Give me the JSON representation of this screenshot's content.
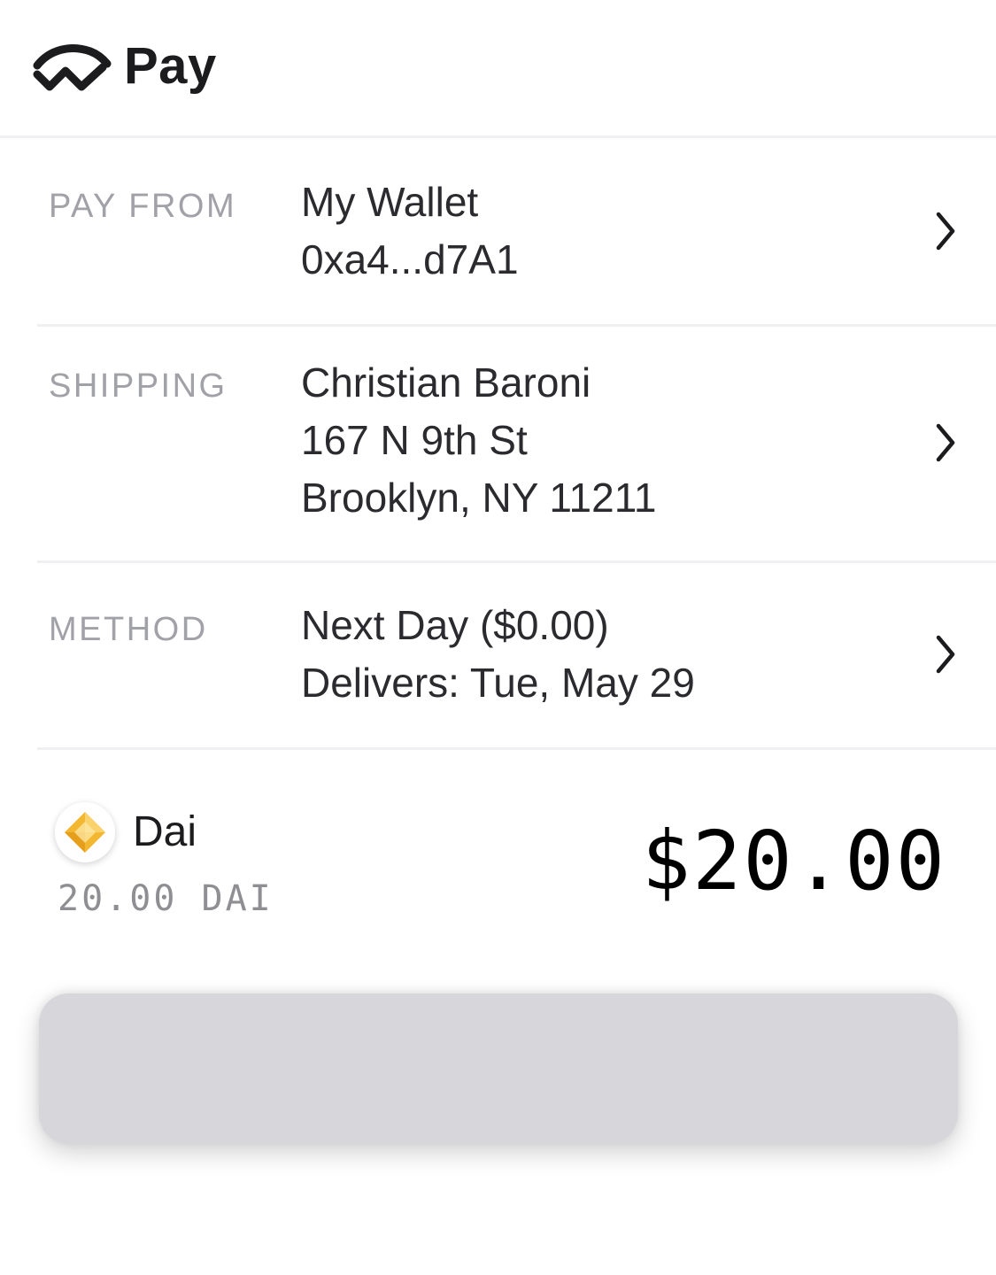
{
  "header": {
    "title": "Pay",
    "logo_icon": "walletconnect-logo-icon"
  },
  "pay_from": {
    "label": "PAY FROM",
    "wallet_name": "My Wallet",
    "address": "0xa4...d7A1",
    "chevron_icon": "chevron-right-icon"
  },
  "shipping": {
    "label": "SHIPPING",
    "name": "Christian Baroni",
    "street": "167 N 9th St",
    "city_line": "Brooklyn, NY 11211",
    "chevron_icon": "chevron-right-icon"
  },
  "method": {
    "label": "METHOD",
    "option": "Next Day ($0.00)",
    "delivery": "Delivers: Tue, May 29",
    "chevron_icon": "chevron-right-icon"
  },
  "summary": {
    "token_icon": "dai-coin-icon",
    "token_name": "Dai",
    "token_amount": "20.00 DAI",
    "fiat_total": "$20.00"
  },
  "colors": {
    "label_gray": "#a1a1a8",
    "text_dark": "#2b2b2f",
    "divider": "#f0f0f2",
    "button_bg": "#d6d6db",
    "dai_gold": "#f4b731"
  }
}
